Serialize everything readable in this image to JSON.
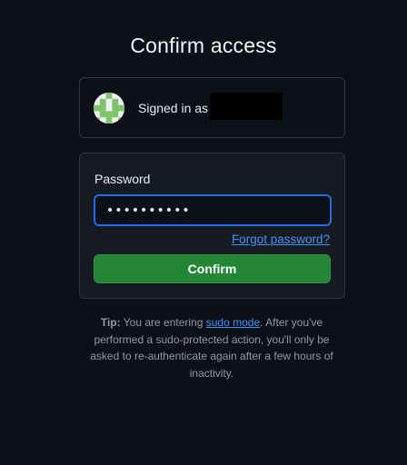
{
  "page": {
    "title": "Confirm access"
  },
  "account": {
    "signed_in_label": "Signed in as"
  },
  "form": {
    "password_label": "Password",
    "password_value": "••••••••••",
    "forgot_link": "Forgot password?",
    "confirm_button": "Confirm"
  },
  "tip": {
    "label": "Tip:",
    "text_before": "You are entering",
    "link": "sudo mode",
    "text_after": ". After you've performed a sudo-protected action, you'll only be asked to re-authenticate again after a few hours of inactivity."
  },
  "colors": {
    "background": "#0d1117",
    "panel": "#161b22",
    "border": "#30363d",
    "focus_ring": "#1f6feb",
    "link": "#4493f8",
    "confirm_green": "#238636",
    "avatar_green": "#7cc36b"
  }
}
